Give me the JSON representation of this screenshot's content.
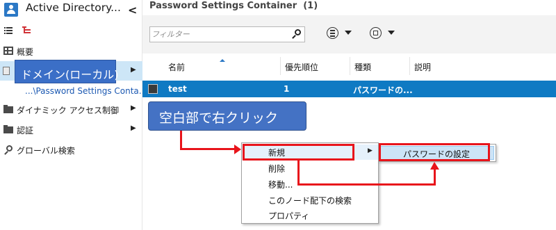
{
  "nav": {
    "title": "Active Directory...",
    "collapse_glyph": "<",
    "items": [
      {
        "label": "概要",
        "icon": "grid-icon",
        "has_children": false
      },
      {
        "label": "ドメイン(ローカル)",
        "icon": "domain-icon",
        "has_children": true,
        "selected": true
      },
      {
        "label": "...\\Password Settings Conta...",
        "icon": "none",
        "has_children": false
      },
      {
        "label": "ダイナミック アクセス制御",
        "icon": "folder-icon",
        "has_children": true
      },
      {
        "label": "認証",
        "icon": "folder-icon",
        "has_children": true
      },
      {
        "label": "グローバル検索",
        "icon": "magnifier-icon",
        "has_children": false
      }
    ]
  },
  "content": {
    "title": "Password Settings Container",
    "count": "(1)",
    "filter_placeholder": "フィルター",
    "columns": [
      "名前",
      "優先順位",
      "種類",
      "説明"
    ],
    "rows": [
      {
        "name": "test",
        "precedence": "1",
        "type": "パスワードの...",
        "description": ""
      }
    ]
  },
  "callout": "空白部で右クリック",
  "context_menu": {
    "items": [
      {
        "label": "新規",
        "has_submenu": true
      },
      {
        "label": "削除",
        "has_submenu": false
      },
      {
        "label": "移動...",
        "has_submenu": false
      },
      {
        "label": "このノード配下の検索",
        "has_submenu": false
      },
      {
        "label": "プロパティ",
        "has_submenu": false
      }
    ],
    "submenu": {
      "label": "パスワードの設定"
    }
  },
  "colors": {
    "selection_blue": "#0f7ac3",
    "callout_blue": "#4472c4",
    "annotation_red": "#e8141b",
    "nav_selection": "#cde6f7"
  }
}
